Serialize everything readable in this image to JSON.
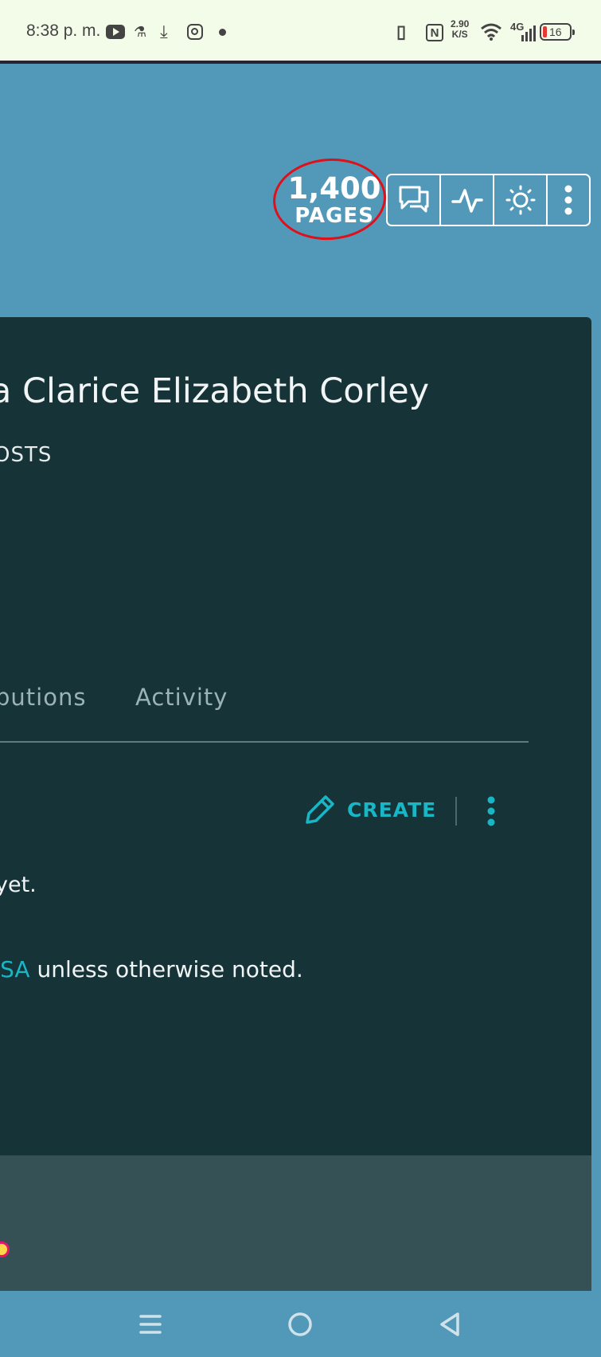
{
  "status_bar": {
    "time": "8:38 p. m.",
    "speed_value": "2.90",
    "speed_unit": "K/S",
    "network": "4G",
    "battery": "16",
    "icons": [
      "youtube-icon",
      "flask-icon",
      "download-icon",
      "instagram-icon",
      "dot-icon",
      "vibrate-icon",
      "nfc-icon",
      "wifi-icon",
      "signal-icon",
      "battery-icon"
    ]
  },
  "header": {
    "pages_count": "1,400",
    "pages_label": "PAGES",
    "toolbar_icons": [
      "discussions-icon",
      "activity-icon",
      "theme-icon",
      "more-icon"
    ]
  },
  "profile": {
    "title": "a Clarice Elizabeth Corley",
    "posts_label": "OSTS"
  },
  "tabs": [
    {
      "label": "butions"
    },
    {
      "label": "Activity"
    }
  ],
  "actions": {
    "create_label": "CREATE"
  },
  "content": {
    "empty_text": "yet.",
    "license_link": "-SA",
    "license_rest": " unless otherwise noted."
  },
  "colors": {
    "background": "#5299b9",
    "card": "#163338",
    "footer": "#355156",
    "accent": "#19b6c6",
    "annotation": "#e0101a"
  }
}
